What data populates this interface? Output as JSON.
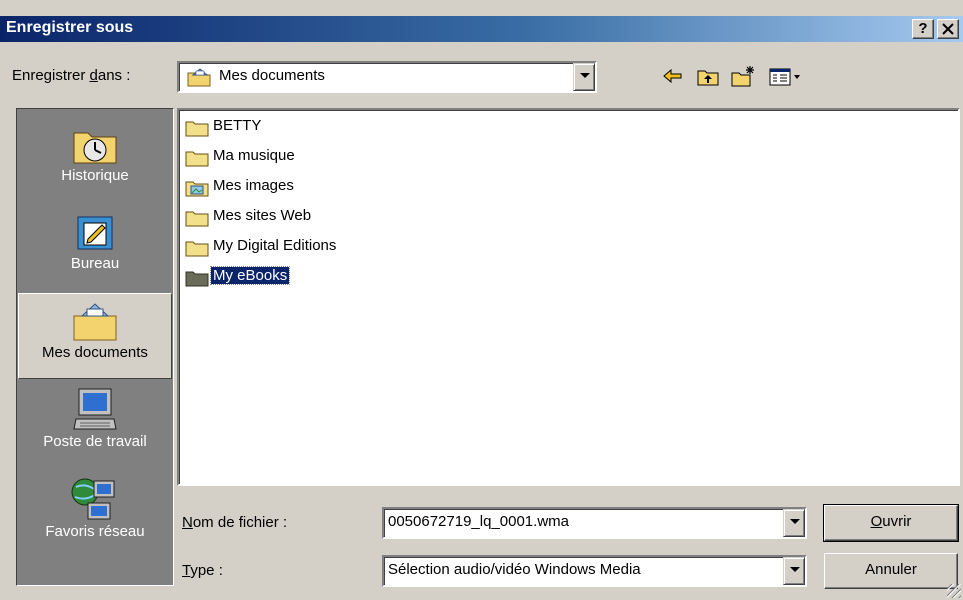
{
  "window": {
    "title": "Enregistrer sous",
    "help_label": "?",
    "close_label": "✕"
  },
  "save_in": {
    "label_prefix": "Enregistrer ",
    "label_access": "d",
    "label_suffix": "ans :",
    "value": "Mes documents",
    "icon": "my-documents-icon"
  },
  "toolbar": {
    "back_icon": "back-arrow-icon",
    "up_icon": "up-folder-icon",
    "new_folder_icon": "new-folder-icon",
    "view_icon": "view-menu-icon"
  },
  "places": [
    {
      "label": "Historique",
      "icon": "history-icon"
    },
    {
      "label": "Bureau",
      "icon": "desktop-icon"
    },
    {
      "label": "Mes documents",
      "icon": "my-documents-icon"
    },
    {
      "label": "Poste de travail",
      "icon": "my-computer-icon"
    },
    {
      "label": "Favoris réseau",
      "icon": "network-places-icon"
    }
  ],
  "files": [
    {
      "label": "BETTY",
      "icon": "folder-icon"
    },
    {
      "label": "Ma musique",
      "icon": "folder-icon"
    },
    {
      "label": "Mes images",
      "icon": "pictures-folder-icon"
    },
    {
      "label": "Mes sites Web",
      "icon": "folder-icon"
    },
    {
      "label": "My Digital Editions",
      "icon": "folder-icon"
    },
    {
      "label": "My eBooks",
      "icon": "folder-icon"
    }
  ],
  "selected_file": "My eBooks",
  "filename": {
    "label_access": "N",
    "label_rest": "om de fichier :",
    "value": "0050672719_lq_0001.wma"
  },
  "type": {
    "label_access": "T",
    "label_rest": "ype :",
    "value": "Sélection audio/vidéo Windows Media"
  },
  "buttons": {
    "open_access": "O",
    "open_rest": "uvrir",
    "cancel": "Annuler"
  },
  "colors": {
    "titlebar_start": "#0a246a",
    "titlebar_end": "#a6caf0",
    "selection": "#0a246a",
    "face": "#d4d0c8"
  }
}
